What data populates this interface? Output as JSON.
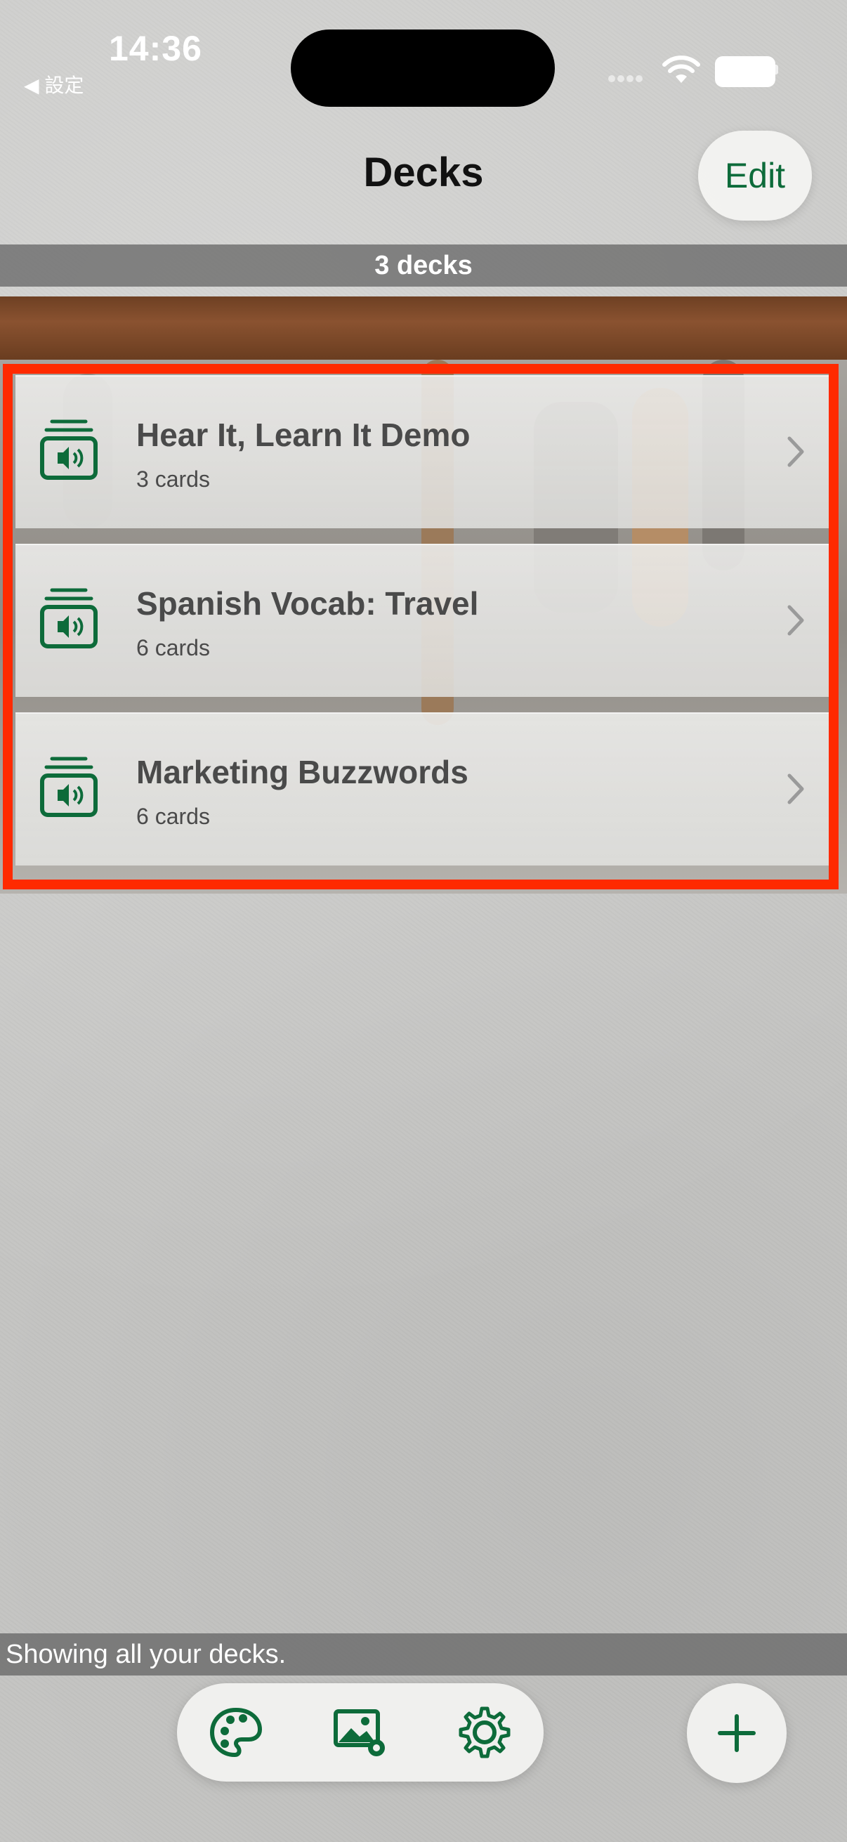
{
  "status": {
    "time": "14:36",
    "back_app": "◀ 設定"
  },
  "header": {
    "title": "Decks",
    "edit_label": "Edit",
    "count_text": "3 decks"
  },
  "decks": [
    {
      "title": "Hear It, Learn It Demo",
      "subtitle": "3 cards",
      "icon": "audio-deck-icon"
    },
    {
      "title": "Spanish Vocab: Travel",
      "subtitle": "6 cards",
      "icon": "audio-deck-icon"
    },
    {
      "title": "Marketing Buzzwords",
      "subtitle": "6 cards",
      "icon": "audio-deck-icon"
    }
  ],
  "footer": {
    "note": "Showing all your decks."
  },
  "toolbar": {
    "items": [
      "palette-icon",
      "image-settings-icon",
      "gear-icon"
    ],
    "add_icon": "plus-icon"
  },
  "colors": {
    "accent": "#0d6b3a",
    "highlight": "#ff2a00"
  }
}
